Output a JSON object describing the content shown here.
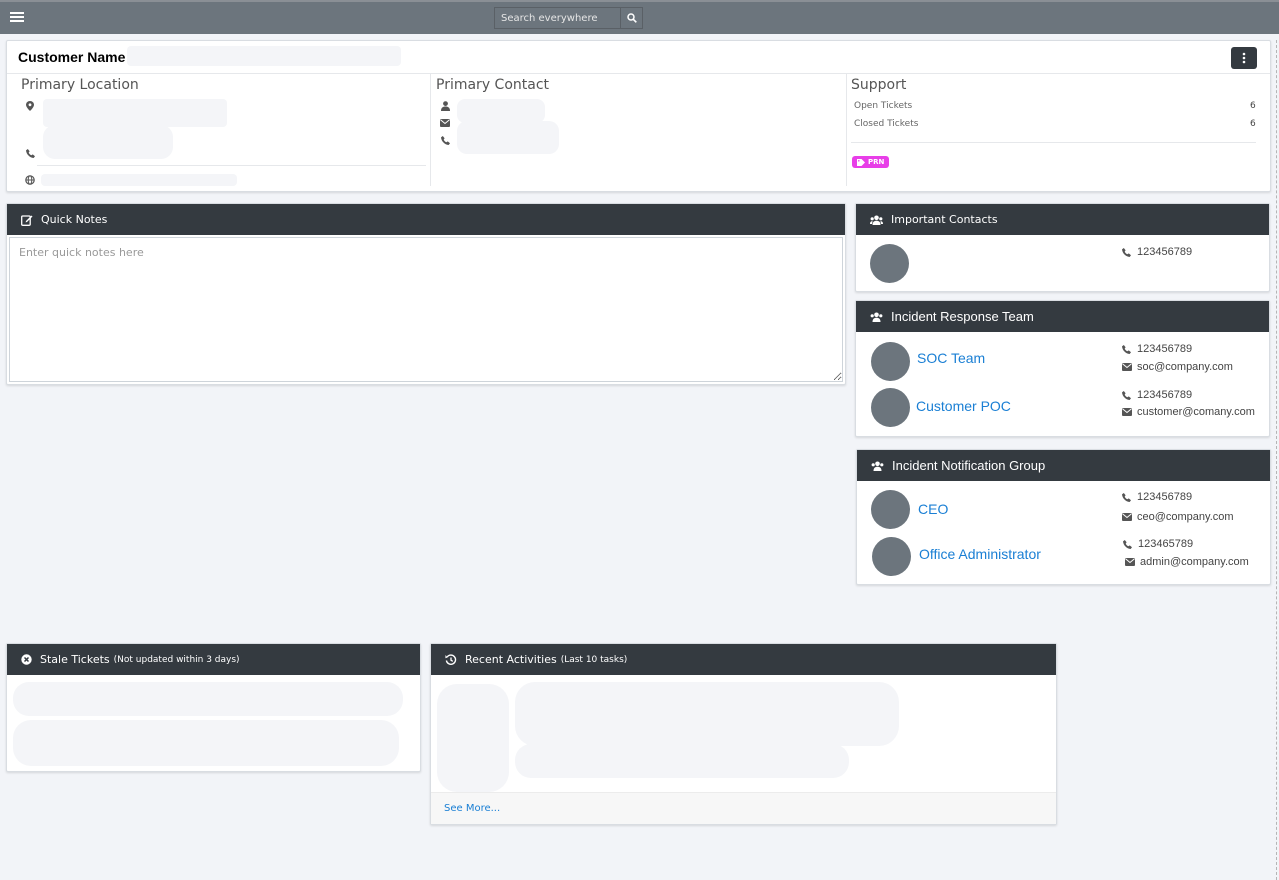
{
  "search": {
    "placeholder": "Search everywhere"
  },
  "customer": {
    "title": "Customer Name",
    "primary_location_label": "Primary Location",
    "primary_contact_label": "Primary Contact",
    "support_label": "Support",
    "support_rows": [
      {
        "label": "Open Tickets",
        "value": "6"
      },
      {
        "label": "Closed Tickets",
        "value": "6"
      }
    ],
    "tag": "PRN"
  },
  "quick_notes": {
    "title": "Quick Notes",
    "placeholder": "Enter quick notes here"
  },
  "important_contacts": {
    "title": "Important Contacts",
    "phone": "123456789"
  },
  "incident_response": {
    "title": "Incident Response Team",
    "members": [
      {
        "name": "SOC Team",
        "phone": "123456789",
        "email": "soc@company.com"
      },
      {
        "name": "Customer POC",
        "phone": "123456789",
        "email": "customer@comany.com"
      }
    ]
  },
  "incident_notification": {
    "title": "Incident Notification Group",
    "members": [
      {
        "name": "CEO",
        "phone": "123456789",
        "email": "ceo@company.com"
      },
      {
        "name": "Office Administrator",
        "phone": "123465789",
        "email": "admin@company.com"
      }
    ]
  },
  "stale_tickets": {
    "title": "Stale Tickets",
    "subtitle": "(Not updated within 3 days)"
  },
  "recent_activities": {
    "title": "Recent Activities",
    "subtitle": "(Last 10 tasks)",
    "see_more": "See More..."
  },
  "colors": {
    "topbar": "#6c757d",
    "header": "#343a40",
    "link": "#1a7fd4",
    "tag": "#e83ee8",
    "avatar": "#6c757d"
  },
  "icons": [
    "menu-icon",
    "search-icon",
    "kebab-icon",
    "map-marker-icon",
    "phone-icon",
    "globe-icon",
    "user-icon",
    "envelope-icon",
    "tag-icon",
    "edit-icon",
    "users-icon",
    "times-circle-icon",
    "history-icon"
  ]
}
